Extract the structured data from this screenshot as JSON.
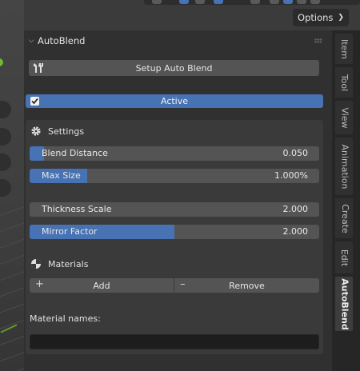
{
  "header": {
    "options_label": "Options"
  },
  "panel": {
    "title": "AutoBlend",
    "setup_button_label": "Setup Auto Blend",
    "active_label": "Active",
    "active_checked": true,
    "settings": {
      "title": "Settings",
      "sliders": [
        {
          "label": "Blend Distance",
          "value": "0.050",
          "fill_fraction": 0.05
        },
        {
          "label": "Max Size",
          "value": "1.000%",
          "fill_fraction": 0.2
        },
        {
          "label": "Thickness Scale",
          "value": "2.000",
          "fill_fraction": 0.0
        },
        {
          "label": "Mirror Factor",
          "value": "2.000",
          "fill_fraction": 0.5
        }
      ]
    },
    "materials": {
      "title": "Materials",
      "add_label": "Add",
      "remove_label": "Remove",
      "names_label": "Material names:",
      "names_value": ""
    }
  },
  "tabs": [
    "Item",
    "Tool",
    "View",
    "Animation",
    "Create",
    "Edit",
    "AutoBlend"
  ],
  "active_tab": "AutoBlend",
  "colors": {
    "accent": "#4772b3",
    "panel_bg": "#303030",
    "button_bg": "#545454"
  }
}
